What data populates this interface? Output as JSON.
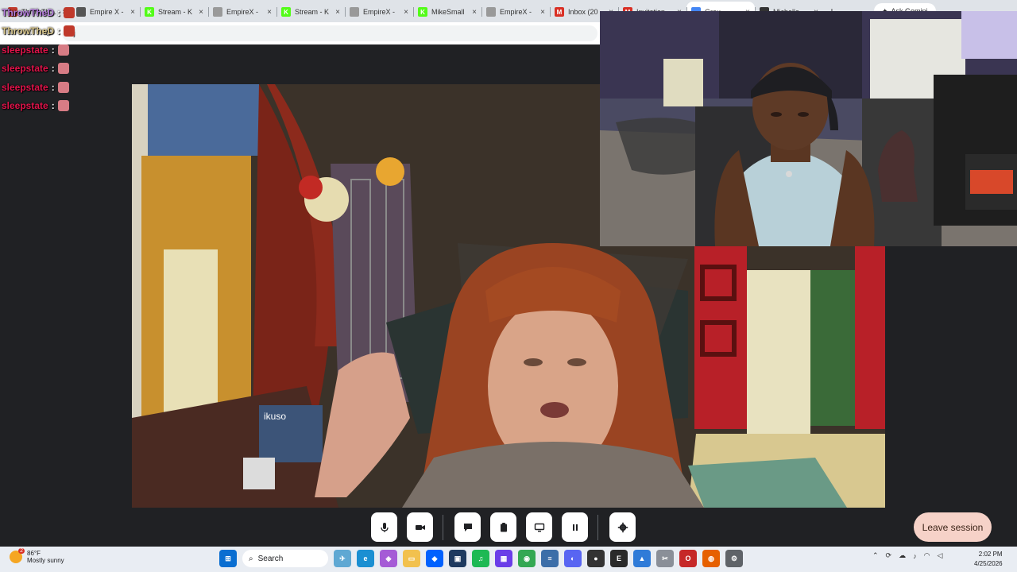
{
  "browser": {
    "tabs": [
      {
        "title": "ThrowTheD :",
        "favicon": "red-devil-icon",
        "color": "#c0392b",
        "glyph": "",
        "active": false
      },
      {
        "title": "Empire X -",
        "favicon": "site-icon",
        "color": "#555555",
        "glyph": "",
        "active": false
      },
      {
        "title": "Stream - K",
        "favicon": "kick-icon",
        "color": "#53fc18",
        "glyph": "K",
        "active": false
      },
      {
        "title": "EmpireX -",
        "favicon": "site-icon",
        "color": "#999999",
        "glyph": "",
        "active": false
      },
      {
        "title": "Stream - K",
        "favicon": "kick-icon",
        "color": "#53fc18",
        "glyph": "K",
        "active": false
      },
      {
        "title": "EmpireX -",
        "favicon": "site-icon",
        "color": "#999999",
        "glyph": "",
        "active": false
      },
      {
        "title": "MikeSmall",
        "favicon": "kick-icon",
        "color": "#53fc18",
        "glyph": "K",
        "active": false
      },
      {
        "title": "EmpireX -",
        "favicon": "site-icon",
        "color": "#999999",
        "glyph": "",
        "active": false
      },
      {
        "title": "Inbox (20",
        "favicon": "gmail-icon",
        "color": "#d93025",
        "glyph": "M",
        "active": false
      },
      {
        "title": "Invitation",
        "favicon": "gmail-icon",
        "color": "#d93025",
        "glyph": "M",
        "active": false
      },
      {
        "title": "Grou",
        "favicon": "site-icon",
        "color": "#4285f4",
        "glyph": "",
        "active": true
      },
      {
        "title": "Michelle",
        "favicon": "site-icon",
        "color": "#333333",
        "glyph": "",
        "active": false
      }
    ],
    "ask_gemini": "Ask Gemini",
    "url": "fj"
  },
  "chat": [
    {
      "user": "ThrowTheD",
      "color": "#b57edc",
      "emote": "red"
    },
    {
      "user": "ThrowTheD",
      "color": "#d6c48a",
      "emote": "red"
    },
    {
      "user": "sleepstate",
      "color": "#e0134a",
      "emote": "pink"
    },
    {
      "user": "sleepstate",
      "color": "#e0134a",
      "emote": "pink"
    },
    {
      "user": "sleepstate",
      "color": "#e0134a",
      "emote": "pink"
    },
    {
      "user": "sleepstate",
      "color": "#e0134a",
      "emote": "pink"
    }
  ],
  "main_video": {
    "sign_text": "ikuso"
  },
  "controls": {
    "leave_label": "Leave session",
    "leave_color": "#f6d2c8"
  },
  "taskbar": {
    "weather_temp": "86°F",
    "weather_desc": "Mostly sunny",
    "weather_badge": "2",
    "search_label": "Search",
    "time": "2:02 PM",
    "date": "4/25/2026"
  }
}
